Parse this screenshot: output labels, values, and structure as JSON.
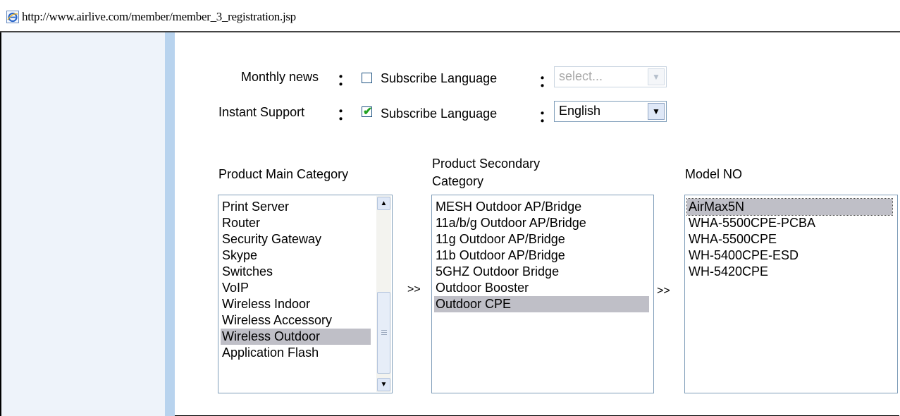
{
  "browser": {
    "url": "http://www.airlive.com/member/member_3_registration.jsp",
    "icon": "ie-page-icon"
  },
  "subscriptions": {
    "monthly_news": {
      "label": "Monthly news",
      "colon": "：",
      "checked": false,
      "subscribe_label": "Subscribe Language",
      "lang_colon": "：",
      "language_value": "select...",
      "disabled": true
    },
    "instant_support": {
      "label": "Instant Support",
      "colon": "：",
      "checked": true,
      "subscribe_label": "Subscribe Language",
      "lang_colon": "：",
      "language_value": "English",
      "disabled": false
    }
  },
  "categories": {
    "main_label": "Product Main Category",
    "secondary_label_line1": "Product Secondary",
    "secondary_label_line2": "Category",
    "model_label": "Model NO",
    "arrow1": ">>",
    "arrow2": ">>",
    "main_items": [
      "Print Server",
      "Router",
      "Security Gateway",
      "Skype",
      "Switches",
      "VoIP",
      "Wireless Indoor",
      "Wireless Accessory",
      "Wireless Outdoor",
      "Application Flash"
    ],
    "main_selected": "Wireless Outdoor",
    "secondary_items": [
      "MESH Outdoor AP/Bridge",
      "11a/b/g Outdoor AP/Bridge",
      "11g Outdoor AP/Bridge",
      "11b Outdoor AP/Bridge",
      "5GHZ Outdoor Bridge",
      "Outdoor Booster",
      "Outdoor CPE"
    ],
    "secondary_selected": "Outdoor CPE",
    "model_items": [
      "AirMax5N",
      "WHA-5500CPE-PCBA",
      "WHA-5500CPE",
      "WH-5400CPE-ESD",
      "WH-5420CPE"
    ],
    "model_selected": "AirMax5N"
  },
  "colors": {
    "sidebar": "#b8d3ee",
    "selection": "#bfbfc7",
    "check": "#21a121"
  }
}
